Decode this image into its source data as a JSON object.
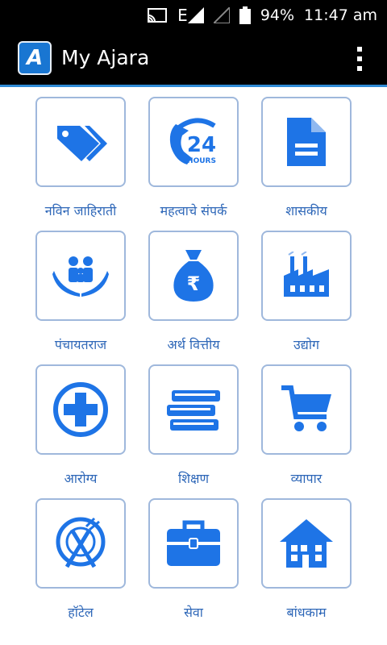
{
  "status_bar": {
    "battery": "94%",
    "time": "11:47 am",
    "network_label": "E"
  },
  "app_bar": {
    "title": "My Ajara",
    "logo_letter": "A"
  },
  "colors": {
    "accent": "#1e74e6",
    "tile_border": "#9fb8dc",
    "label": "#2e67b8"
  },
  "tiles": [
    {
      "label": "नविन जाहिराती",
      "icon": "tags-icon"
    },
    {
      "label": "महत्वाचे संपर्क",
      "icon": "phone-24-hours-icon",
      "icon_text_big": "24",
      "icon_text_small": "HOURS"
    },
    {
      "label": "शासकीय",
      "icon": "document-icon"
    },
    {
      "label": "पंचायतराज",
      "icon": "family-hands-icon"
    },
    {
      "label": "अर्थ वित्तीय",
      "icon": "money-bag-icon",
      "icon_text": "₹"
    },
    {
      "label": "उद्योग",
      "icon": "factory-icon"
    },
    {
      "label": "आरोग्य",
      "icon": "medical-cross-icon"
    },
    {
      "label": "शिक्षण",
      "icon": "books-icon"
    },
    {
      "label": "व्यापार",
      "icon": "shopping-cart-icon"
    },
    {
      "label": "हॉटेल",
      "icon": "plate-cutlery-icon"
    },
    {
      "label": "सेवा",
      "icon": "briefcase-icon"
    },
    {
      "label": "बांधकाम",
      "icon": "house-icon"
    }
  ]
}
